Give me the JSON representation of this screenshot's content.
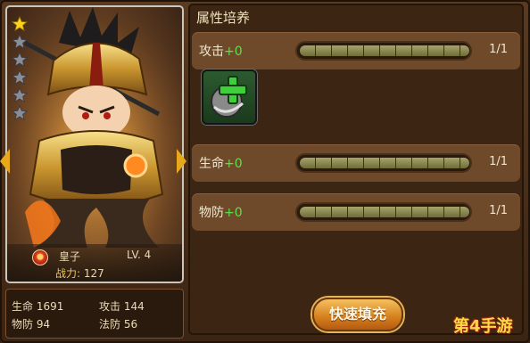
{
  "panel": {
    "title": "属性培养"
  },
  "card": {
    "name": "皇子",
    "level": "LV. 4",
    "power_label": "战力:",
    "power_value": "127",
    "stars_total": 6,
    "stars_filled": 1
  },
  "stats": {
    "hp": "生命 1691",
    "attack": "攻击 144",
    "pdef": "物防 94",
    "mdef": "法防 56"
  },
  "attributes": [
    {
      "label": "攻击",
      "bonus": "+0",
      "value": "1/1",
      "fill": 1.0
    },
    {
      "label": "生命",
      "bonus": "+0",
      "value": "1/1",
      "fill": 1.0
    },
    {
      "label": "物防",
      "bonus": "+0",
      "value": "1/1",
      "fill": 1.0
    }
  ],
  "buttons": {
    "quick_fill": "快速填充"
  },
  "watermark": "第4手游",
  "colors": {
    "accent": "#e8a81b",
    "bonus_green": "#5ee04a",
    "row_bg": "#6e4a2b"
  }
}
